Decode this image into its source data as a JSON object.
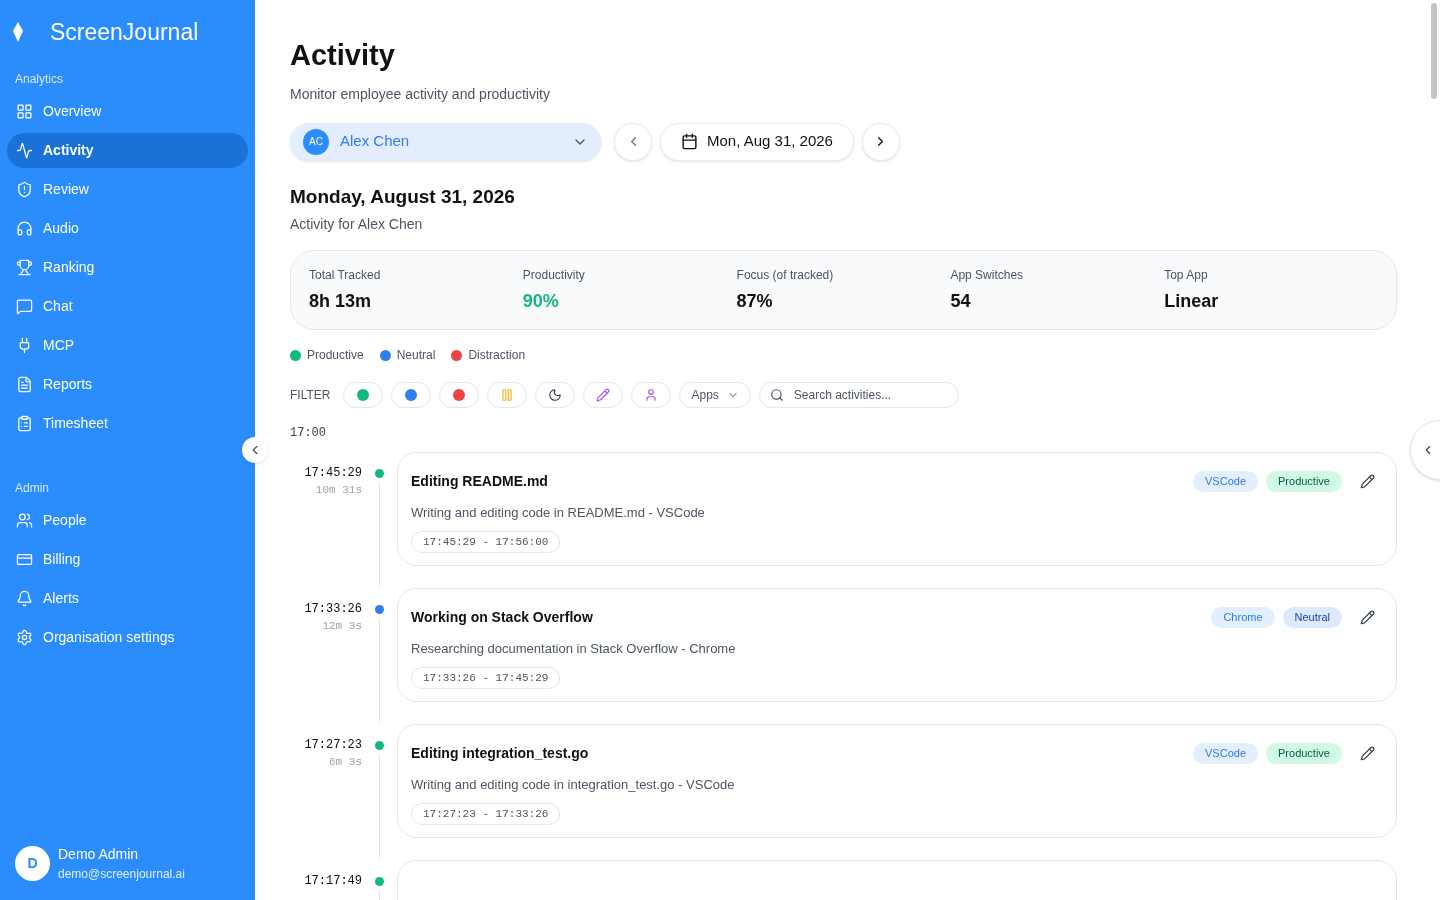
{
  "brand": "ScreenJournal",
  "sidebar": {
    "sections": [
      {
        "title": "Analytics",
        "items": [
          {
            "label": "Overview",
            "selected": false
          },
          {
            "label": "Activity",
            "selected": true
          },
          {
            "label": "Review",
            "selected": false
          },
          {
            "label": "Audio",
            "selected": false
          },
          {
            "label": "Ranking",
            "selected": false
          },
          {
            "label": "Chat",
            "selected": false
          },
          {
            "label": "MCP",
            "selected": false
          },
          {
            "label": "Reports",
            "selected": false
          },
          {
            "label": "Timesheet",
            "selected": false
          }
        ]
      },
      {
        "title": "Admin",
        "items": [
          {
            "label": "People",
            "selected": false
          },
          {
            "label": "Billing",
            "selected": false
          },
          {
            "label": "Alerts",
            "selected": false
          },
          {
            "label": "Organisation settings",
            "selected": false
          }
        ]
      }
    ],
    "user": {
      "initial": "D",
      "name": "Demo Admin",
      "email": "demo@screenjournal.ai"
    }
  },
  "header": {
    "title": "Activity",
    "subtitle": "Monitor employee activity and productivity"
  },
  "employee_select": {
    "initials": "AC",
    "value": "Alex Chen"
  },
  "date_picker": {
    "value": "Mon, Aug 31, 2026"
  },
  "day": {
    "title": "Monday, August 31, 2026",
    "subtitle": "Activity for Alex Chen"
  },
  "stats": [
    {
      "label": "Total Tracked",
      "value": "8h 13m",
      "kind": "plain"
    },
    {
      "label": "Productivity",
      "value": "90%",
      "kind": "good"
    },
    {
      "label": "Focus (of tracked)",
      "value": "87%",
      "kind": "plain"
    },
    {
      "label": "App Switches",
      "value": "54",
      "kind": "plain"
    },
    {
      "label": "Top App",
      "value": "Linear",
      "kind": "plain"
    }
  ],
  "legend": [
    {
      "label": "Productive",
      "color": "#10b981"
    },
    {
      "label": "Neutral",
      "color": "#2f80ed"
    },
    {
      "label": "Distraction",
      "color": "#ef4444"
    }
  ],
  "filter": {
    "label": "FILTER",
    "chips": [
      {
        "kind": "dot",
        "color": "#10b981"
      },
      {
        "kind": "dot",
        "color": "#2f80ed"
      },
      {
        "kind": "dot",
        "color": "#ef4444"
      },
      {
        "kind": "pause"
      },
      {
        "kind": "moon"
      },
      {
        "kind": "pencil"
      },
      {
        "kind": "person"
      }
    ],
    "apps": "Apps",
    "search_placeholder": "Search activities..."
  },
  "hour": "17:00",
  "activities": [
    {
      "time": "17:45:29",
      "duration": "10m 31s",
      "color": "#10b981",
      "title": "Editing README.md",
      "app": "VSCode",
      "category": {
        "label": "Productive",
        "kind": "productive"
      },
      "description": "Writing and editing code in README.md - VSCode",
      "range": "17:45:29 - 17:56:00"
    },
    {
      "time": "17:33:26",
      "duration": "12m 3s",
      "color": "#2f80ed",
      "title": "Working on Stack Overflow",
      "app": "Chrome",
      "category": {
        "label": "Neutral",
        "kind": "neutral"
      },
      "description": "Researching documentation in Stack Overflow - Chrome",
      "range": "17:33:26 - 17:45:29"
    },
    {
      "time": "17:27:23",
      "duration": "6m 3s",
      "color": "#10b981",
      "title": "Editing integration_test.go",
      "app": "VSCode",
      "category": {
        "label": "Productive",
        "kind": "productive"
      },
      "description": "Writing and editing code in integration_test.go - VSCode",
      "range": "17:27:23 - 17:33:26"
    },
    {
      "time": "17:17:49",
      "color": "#10b981"
    }
  ]
}
